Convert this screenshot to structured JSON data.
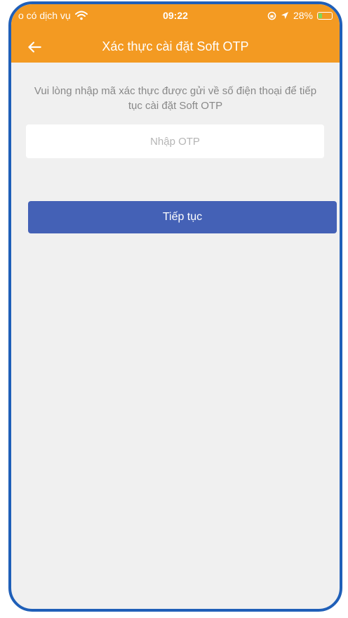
{
  "status_bar": {
    "carrier": "o có dịch vụ",
    "time": "09:22",
    "battery_percent": "28%",
    "battery_level": 0.28
  },
  "header": {
    "title": "Xác thực cài đặt Soft OTP"
  },
  "main": {
    "description": "Vui lòng nhập mã xác thực được gửi về số điện thoại để tiếp tục cài đặt Soft OTP",
    "otp_placeholder": "Nhập OTP",
    "otp_value": "",
    "continue_label": "Tiếp tục"
  },
  "colors": {
    "header": "#f39a22",
    "button": "#4461b6",
    "background": "#f0f0f0",
    "frame_border": "#1f5fb8"
  }
}
